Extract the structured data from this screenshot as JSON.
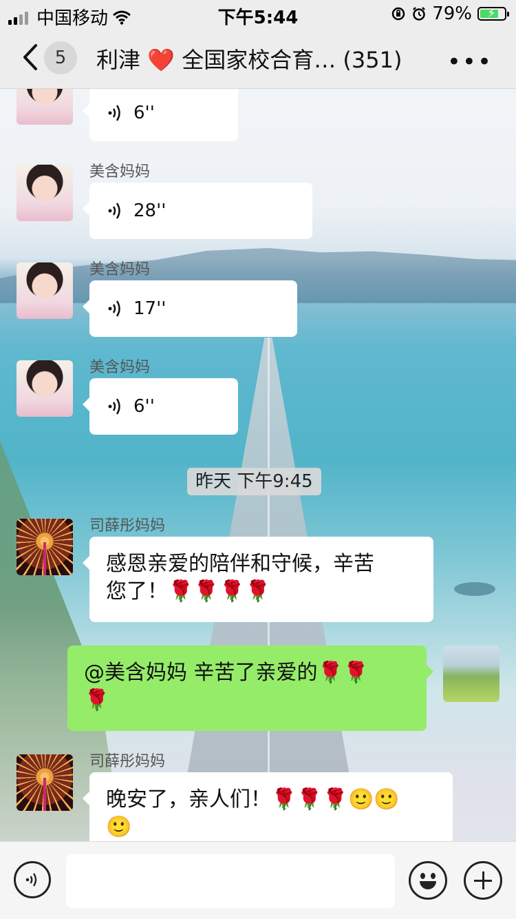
{
  "status_bar": {
    "carrier": "中国移动",
    "time": "下午5:44",
    "battery_percent": "79%",
    "battery_level": 0.79,
    "battery_color": "#4cd964",
    "icons": [
      "signal-icon",
      "wifi-icon",
      "rotation-lock-icon",
      "alarm-icon",
      "battery-icon"
    ]
  },
  "nav": {
    "back_icon": "chevron-left-icon",
    "unread_count": "5",
    "title_prefix": "利津",
    "title_heart": "❤️",
    "title_text": "全国家校合育…",
    "member_count": "(351)",
    "more_icon": "ellipsis-icon"
  },
  "messages": [
    {
      "sender": "",
      "type": "voice",
      "duration": "6''"
    },
    {
      "sender": "美含妈妈",
      "type": "voice",
      "duration": "28''"
    },
    {
      "sender": "美含妈妈",
      "type": "voice",
      "duration": "17''"
    },
    {
      "sender": "美含妈妈",
      "type": "voice",
      "duration": "6''"
    },
    {
      "sender": "司薛彤妈妈",
      "type": "text",
      "line1": "感恩亲爱的陪伴和守候，辛苦",
      "line2": "您了！🌹🌹🌹🌹"
    },
    {
      "sender": "me",
      "type": "text",
      "line1": "@美含妈妈 辛苦了亲爱的🌹🌹",
      "line2": "🌹"
    },
    {
      "sender": "司薛彤妈妈",
      "type": "text",
      "line1": "晚安了，亲人们！🌹🌹🌹🙂🙂",
      "line2": "🙂"
    }
  ],
  "timestamp": "昨天 下午9:45",
  "input_bar": {
    "voice_icon": "voice-icon",
    "input_value": "",
    "emoji_icon": "emoji-icon",
    "plus_icon": "plus-icon"
  },
  "colors": {
    "nav_bg": "#ededed",
    "my_bubble": "#95ec69",
    "other_bubble": "#ffffff"
  }
}
